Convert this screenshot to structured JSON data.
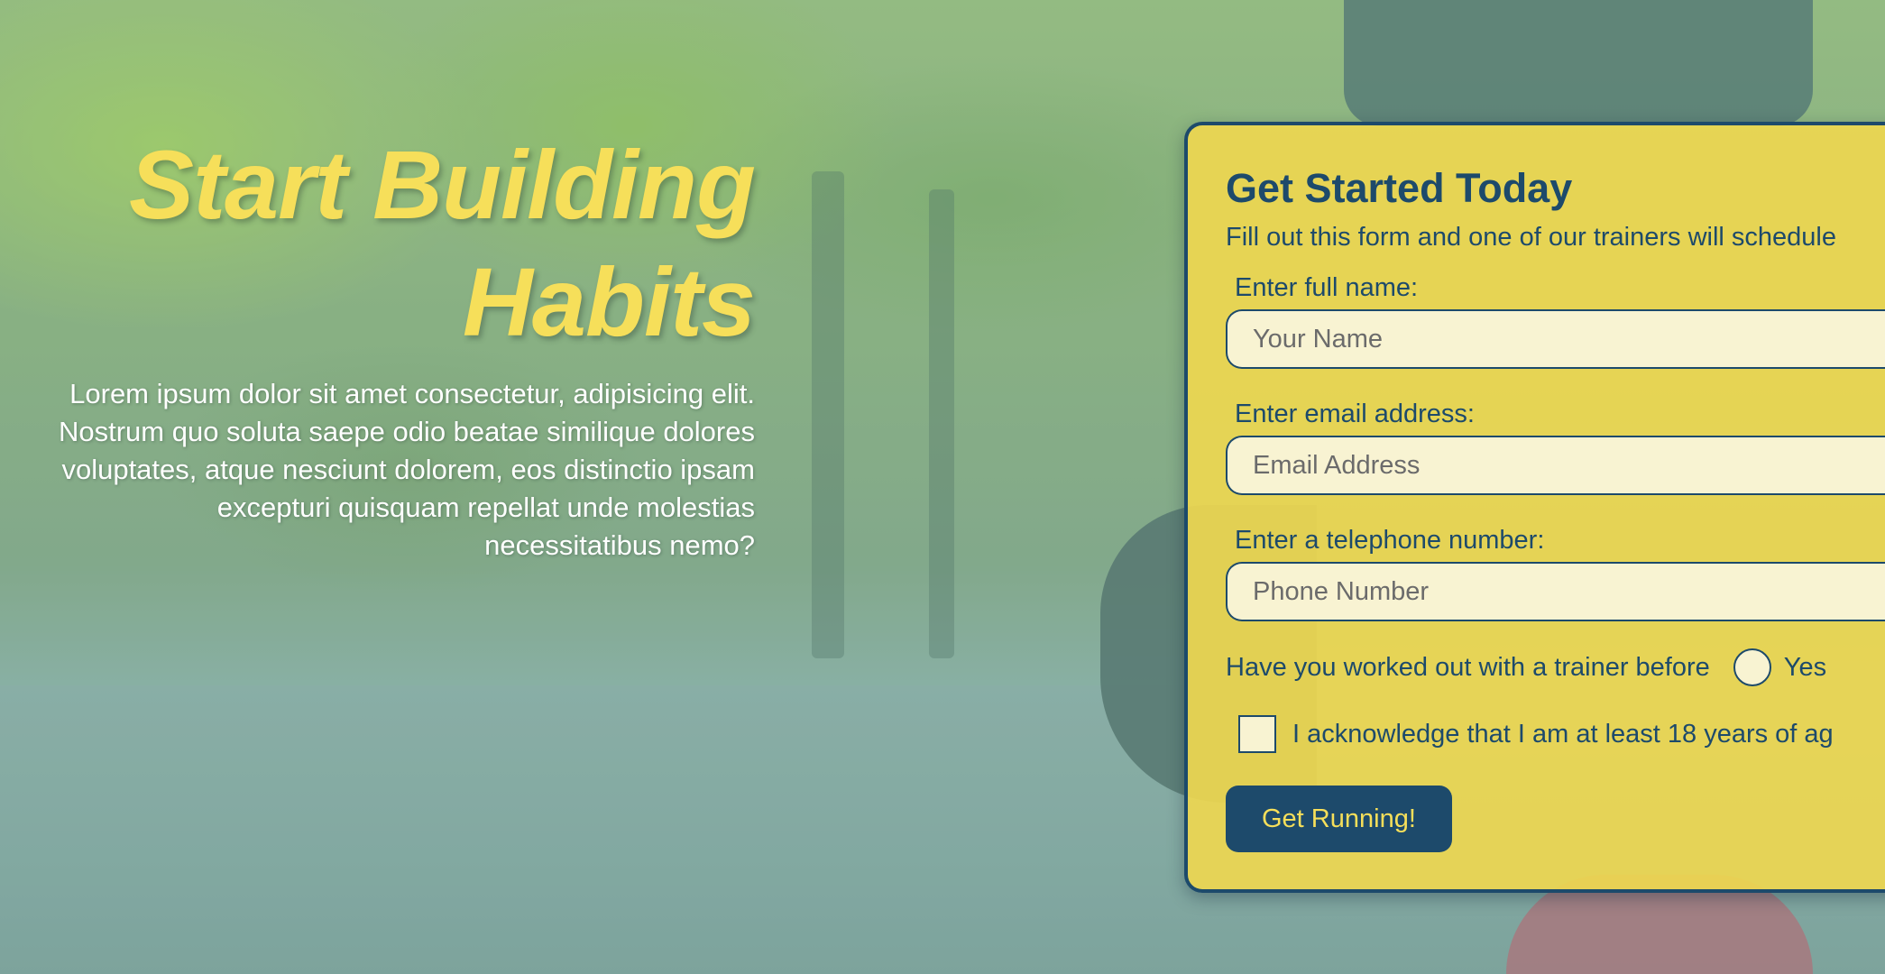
{
  "hero": {
    "title_line1": "Start Building",
    "title_line2": "Habits",
    "body_lines": [
      "Lorem ipsum dolor sit amet consectetur, adipisicing elit.",
      "Nostrum quo soluta saepe odio beatae similique dolores",
      "voluptates, atque nesciunt dolorem, eos distinctio ipsam",
      "excepturi quisquam repellat unde molestias",
      "necessitatibus nemo?"
    ]
  },
  "form": {
    "heading": "Get Started Today",
    "subheading": "Fill out this form and one of our trainers will schedule",
    "name": {
      "label": "Enter full name:",
      "placeholder": "Your Name"
    },
    "email": {
      "label": "Enter email address:",
      "placeholder": "Email Address"
    },
    "phone": {
      "label": "Enter a telephone number:",
      "placeholder": "Phone Number"
    },
    "trainer_question": "Have you worked out with a trainer before",
    "trainer_yes": "Yes",
    "acknowledge": "I acknowledge that I am at least 18 years of ag",
    "submit_label": "Get Running!"
  },
  "colors": {
    "accent_yellow": "#f6df5a",
    "navy": "#1d4a6b",
    "card_bg": "#eed750",
    "input_bg": "#f8f3d2"
  }
}
